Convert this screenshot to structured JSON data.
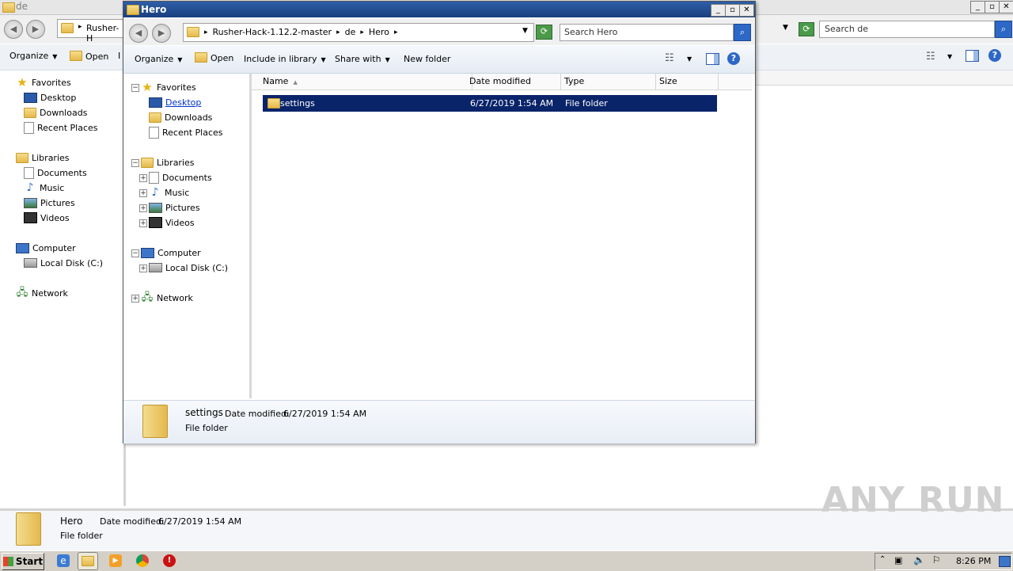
{
  "background_window": {
    "title": "de",
    "address_segment": "Rusher-H",
    "search_placeholder": "Search de",
    "toolbar": {
      "organize": "Organize",
      "open": "Open",
      "truncated": "I"
    },
    "nav": {
      "favorites": "Favorites",
      "desktop": "Desktop",
      "downloads": "Downloads",
      "recent": "Recent Places",
      "libraries": "Libraries",
      "documents": "Documents",
      "music": "Music",
      "pictures": "Pictures",
      "videos": "Videos",
      "computer": "Computer",
      "local_disk": "Local Disk (C:)",
      "network": "Network"
    },
    "details": {
      "name": "Hero",
      "modified_label": "Date modified:",
      "modified_value": "6/27/2019 1:54 AM",
      "type": "File folder"
    }
  },
  "window": {
    "title": "Hero",
    "breadcrumb": [
      "Rusher-Hack-1.12.2-master",
      "de",
      "Hero"
    ],
    "search_placeholder": "Search Hero",
    "toolbar": {
      "organize": "Organize",
      "open": "Open",
      "include_in_library": "Include in library",
      "share_with": "Share with",
      "new_folder": "New folder"
    },
    "nav": {
      "favorites": "Favorites",
      "desktop": "Desktop",
      "downloads": "Downloads",
      "recent": "Recent Places",
      "libraries": "Libraries",
      "documents": "Documents",
      "music": "Music",
      "pictures": "Pictures",
      "videos": "Videos",
      "computer": "Computer",
      "local_disk": "Local Disk (C:)",
      "network": "Network"
    },
    "columns": {
      "name": "Name",
      "date": "Date modified",
      "type": "Type",
      "size": "Size"
    },
    "files": [
      {
        "name": "settings",
        "date": "6/27/2019 1:54 AM",
        "type": "File folder",
        "size": ""
      }
    ],
    "details": {
      "name": "settings",
      "modified_label": "Date modified:",
      "modified_value": "6/27/2019 1:54 AM",
      "type": "File folder"
    }
  },
  "taskbar": {
    "start": "Start",
    "clock": "8:26 PM"
  },
  "watermark": "ANY RUN"
}
